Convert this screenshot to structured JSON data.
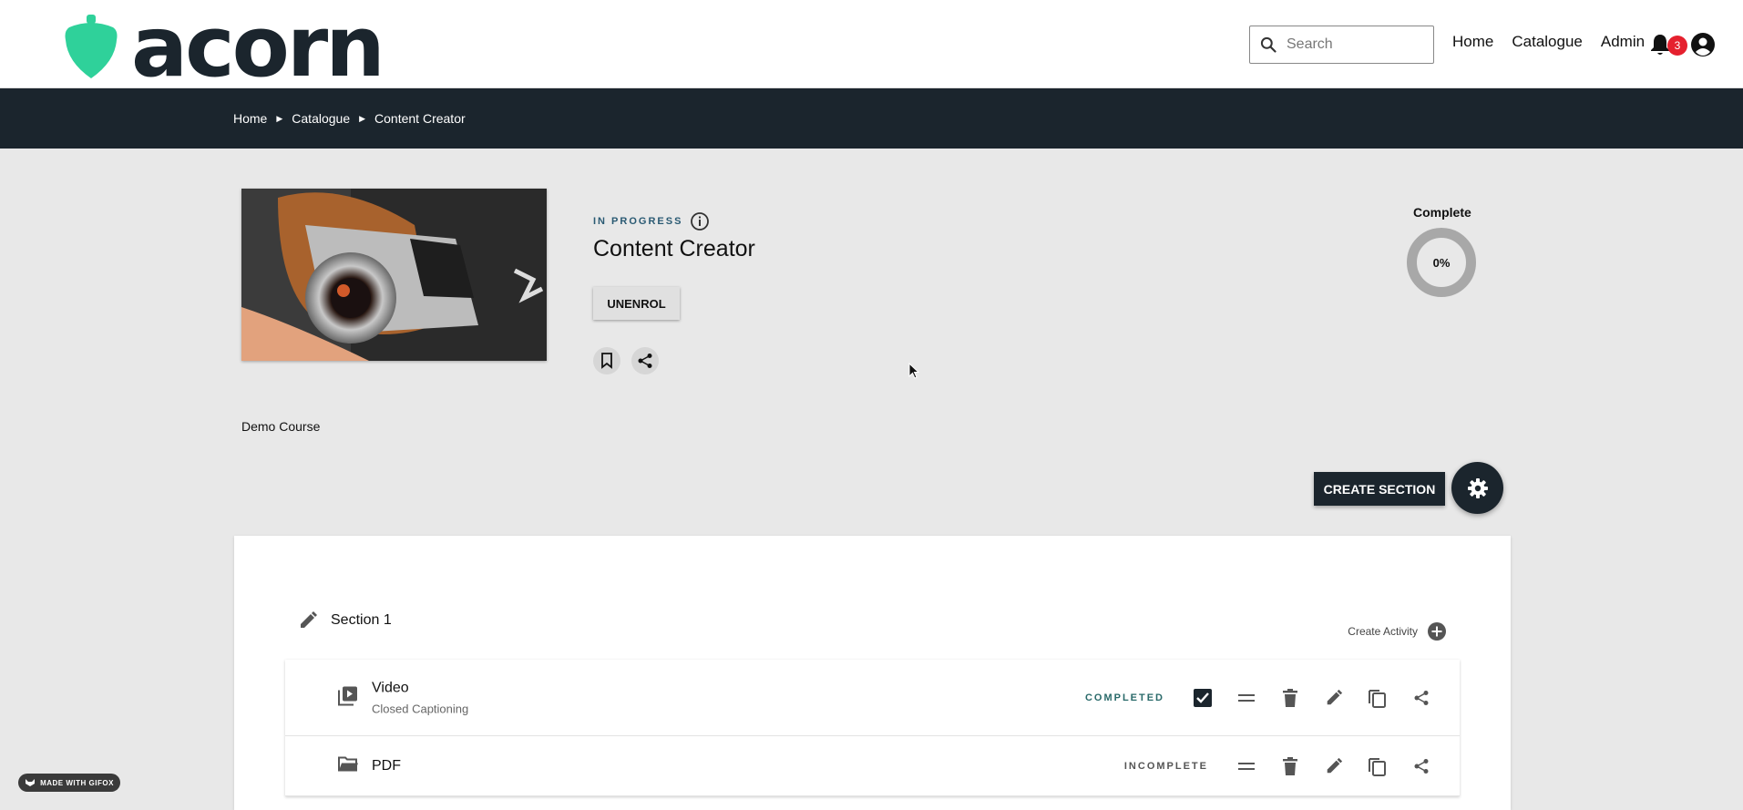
{
  "header": {
    "logo_text": "acorn",
    "search_placeholder": "Search",
    "nav": [
      "Home",
      "Catalogue",
      "Admin"
    ],
    "notification_count": "3"
  },
  "breadcrumb": [
    "Home",
    "Catalogue",
    "Content Creator"
  ],
  "course": {
    "status": "IN PROGRESS",
    "title": "Content Creator",
    "unenrol_label": "UNENROL",
    "progress_label": "Complete",
    "progress_value": "0%",
    "description": "Demo Course"
  },
  "actions": {
    "create_section_label": "CREATE SECTION"
  },
  "section": {
    "title": "Section 1",
    "create_activity_label": "Create Activity",
    "activities": [
      {
        "title": "Video",
        "subtitle": "Closed Captioning",
        "status": "COMPLETED",
        "icon": "video-library-icon"
      },
      {
        "title": "PDF",
        "subtitle": "",
        "status": "INCOMPLETE",
        "icon": "folder-open-icon"
      }
    ]
  },
  "watermark": "MADE WITH GIFOX",
  "colors": {
    "brand": "#2fd19a",
    "dark": "#1b252d",
    "badge": "#e5202e"
  }
}
